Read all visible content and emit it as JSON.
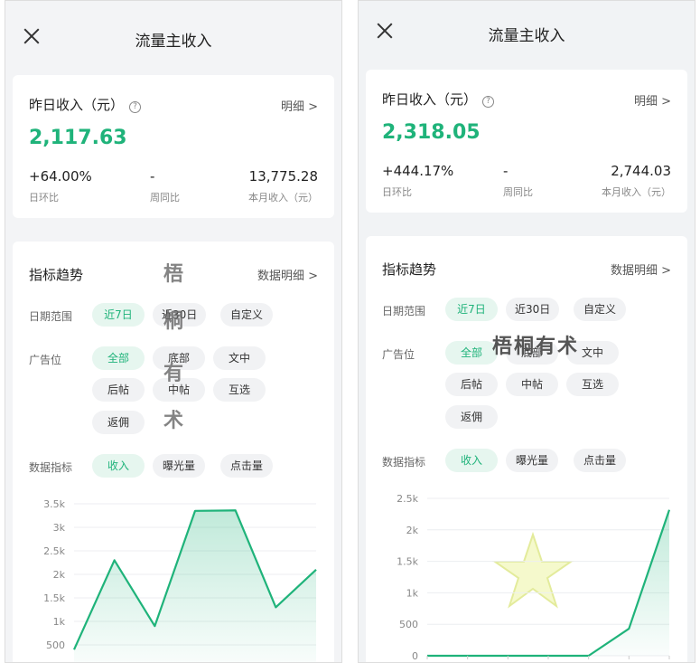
{
  "page_title": "流量主收入",
  "left": {
    "yesterday_label": "昨日收入（元）",
    "detail_link": "明细 >",
    "yesterday_value": "2,117.63",
    "stats": [
      {
        "value": "+64.00%",
        "label": "日环比"
      },
      {
        "value": "-",
        "label": "周同比"
      },
      {
        "value": "13,775.28",
        "label": "本月收入（元）"
      }
    ],
    "trend_title": "指标趋势",
    "trend_detail": "数据明细 >",
    "date_label": "日期范围",
    "date_chips": [
      "近7日",
      "近30日",
      "自定义"
    ],
    "ad_label": "广告位",
    "ad_chips": [
      "全部",
      "底部",
      "文中",
      "后帖",
      "中帖",
      "互选",
      "返佣"
    ],
    "metric_label": "数据指标",
    "metric_chips": [
      "收入",
      "曝光量",
      "点击量"
    ],
    "watermark": [
      "梧",
      "桐",
      "有",
      "术"
    ]
  },
  "right": {
    "yesterday_label": "昨日收入（元）",
    "detail_link": "明细 >",
    "yesterday_value": "2,318.05",
    "stats": [
      {
        "value": "+444.17%",
        "label": "日环比"
      },
      {
        "value": "-",
        "label": "周同比"
      },
      {
        "value": "2,744.03",
        "label": "本月收入（元）"
      }
    ],
    "trend_title": "指标趋势",
    "trend_detail": "数据明细 >",
    "date_label": "日期范围",
    "date_chips": [
      "近7日",
      "近30日",
      "自定义"
    ],
    "ad_label": "广告位",
    "ad_chips": [
      "全部",
      "底部",
      "文中",
      "后帖",
      "中帖",
      "互选",
      "返佣"
    ],
    "metric_label": "数据指标",
    "metric_chips": [
      "收入",
      "曝光量",
      "点击量"
    ],
    "watermark": "梧桐有术"
  },
  "chart_data": [
    {
      "type": "area",
      "ylim": [
        0,
        3500
      ],
      "yticks": [
        "500",
        "1k",
        "1.5k",
        "2k",
        "2.5k",
        "3k",
        "3.5k"
      ],
      "ytick_values": [
        500,
        1000,
        1500,
        2000,
        2500,
        3000,
        3500
      ],
      "values": [
        400,
        2300,
        900,
        3350,
        3360,
        1300,
        2100
      ],
      "color": "#1fb37a"
    },
    {
      "type": "area",
      "ylim": [
        0,
        2500
      ],
      "yticks": [
        "0",
        "500",
        "1k",
        "1.5k",
        "2k",
        "2.5k"
      ],
      "ytick_values": [
        0,
        500,
        1000,
        1500,
        2000,
        2500
      ],
      "values": [
        0,
        0,
        0,
        0,
        0,
        430,
        2318
      ],
      "color": "#1fb37a"
    }
  ]
}
